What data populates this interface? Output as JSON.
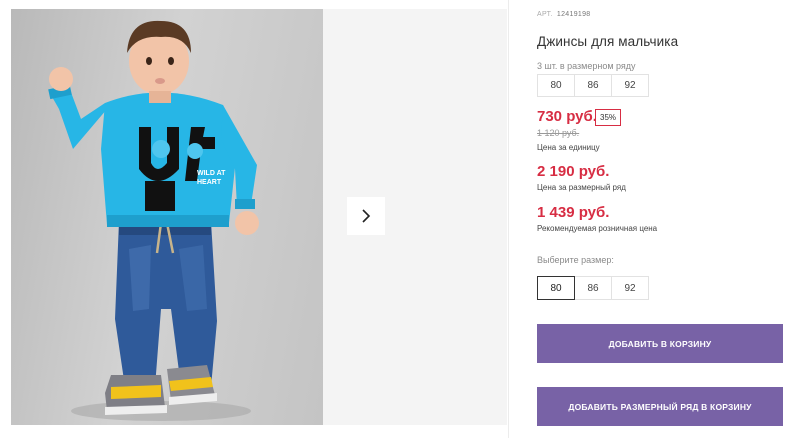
{
  "product": {
    "art_label": "АРТ.",
    "art_number": "12419198",
    "title": "Джинсы для мальчика"
  },
  "pack": {
    "label": "3 шт. в размерном ряду",
    "sizes": [
      "80",
      "86",
      "92"
    ]
  },
  "prices": {
    "unit_price": "730 руб.",
    "discount": "35%",
    "old_price": "1 120 руб.",
    "unit_caption": "Цена за единицу",
    "row_price": "2 190 руб.",
    "row_caption": "Цена за размерный ряд",
    "rrp_price": "1 439 руб.",
    "rrp_caption": "Рекомендуемая розничная цена"
  },
  "size_select": {
    "label": "Выберите размер:",
    "options": [
      "80",
      "86",
      "92"
    ],
    "selected": "80"
  },
  "buttons": {
    "add_to_cart": "ДОБАВИТЬ В КОРЗИНУ",
    "add_row_to_cart": "ДОБАВИТЬ РАЗМЕРНЫЙ РЯД В КОРЗИНУ"
  },
  "gallery": {
    "sweatshirt_print_text": "WILD AT HEART",
    "next_icon": "chevron-right-icon"
  },
  "colors": {
    "price_red": "#d72d43",
    "button_purple": "#7862a6",
    "sweatshirt_blue": "#27b6e6",
    "jeans_blue": "#2f5a9a"
  }
}
